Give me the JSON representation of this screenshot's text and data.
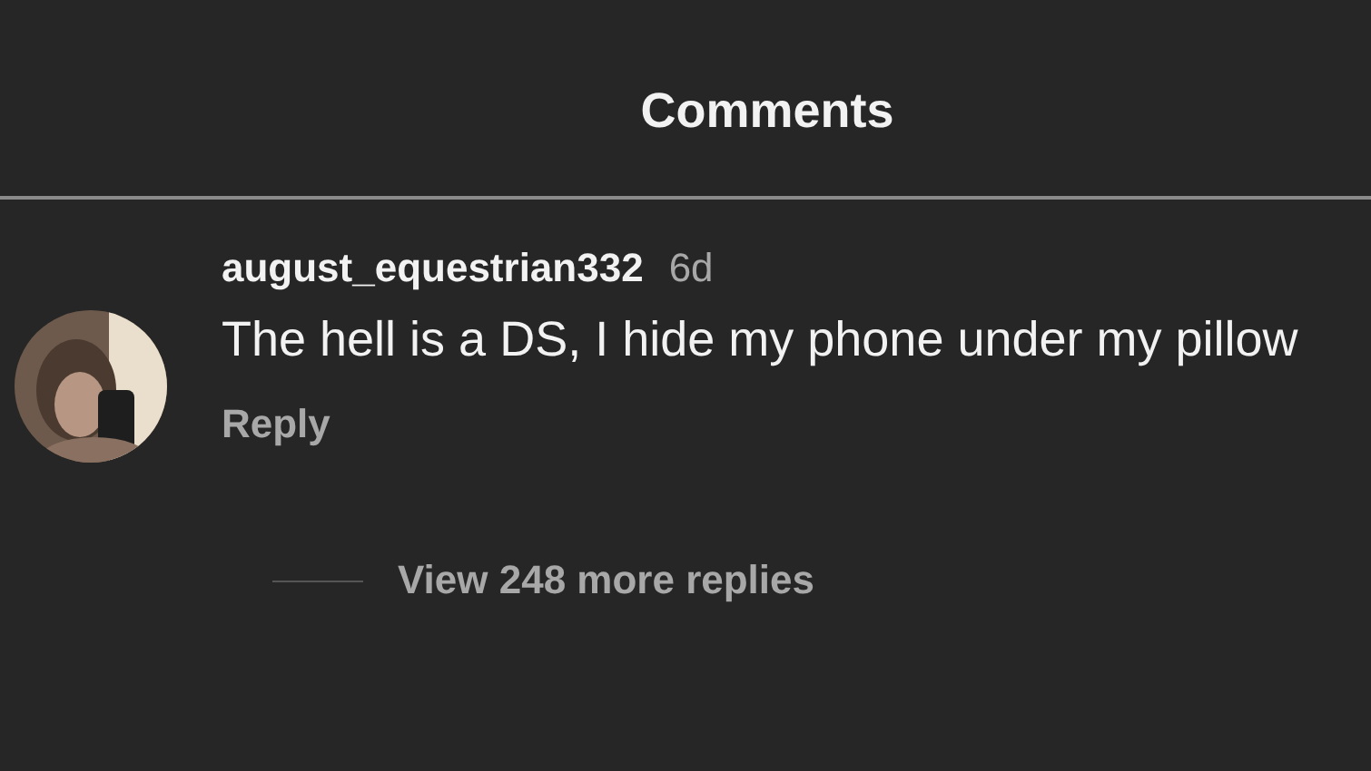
{
  "header": {
    "title": "Comments"
  },
  "comments": [
    {
      "username": "august_equestrian332",
      "time": "6d",
      "text": "The hell is a DS, I hide my phone under my pillow",
      "reply": "Reply",
      "view_replies": "View 248 more replies"
    }
  ]
}
